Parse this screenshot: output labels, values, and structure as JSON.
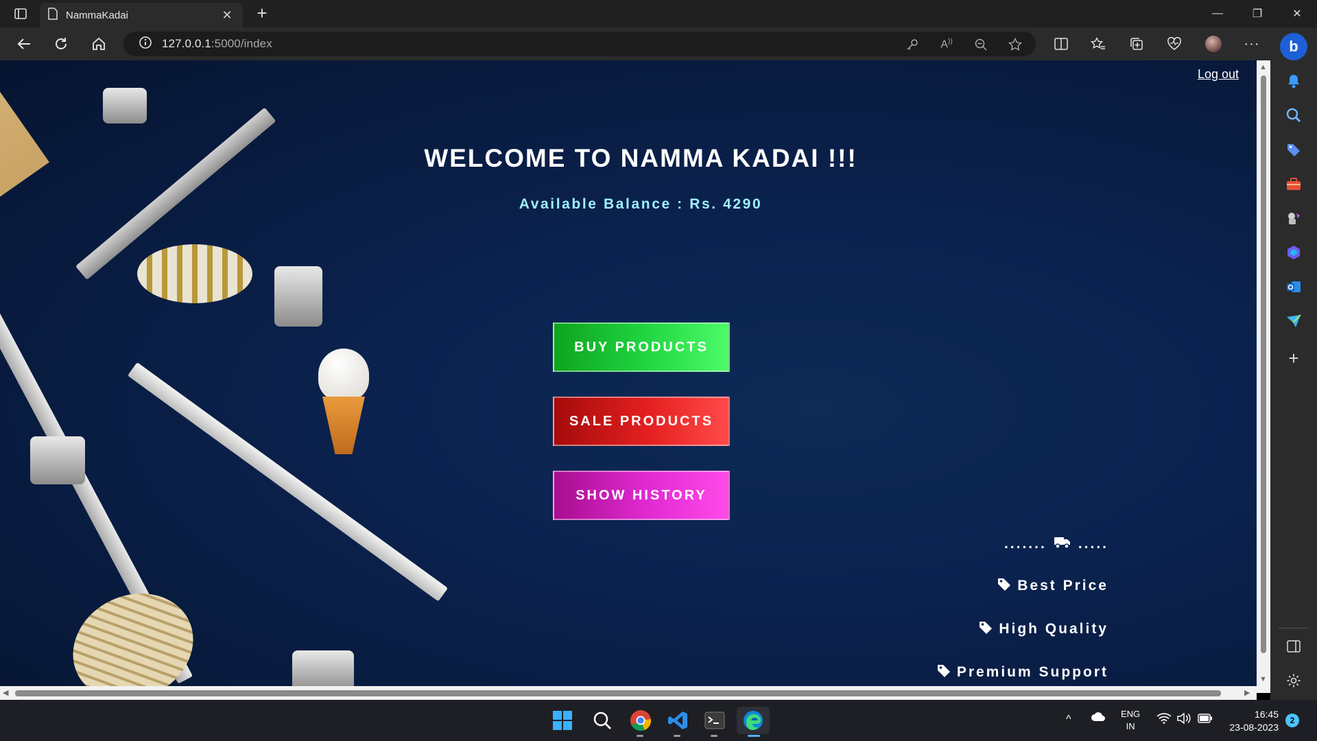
{
  "browser": {
    "tab_title": "NammaKadai",
    "url_host": "127.0.0.1",
    "url_path": ":5000/index"
  },
  "page": {
    "logout_label": "Log out",
    "welcome": "WELCOME TO NAMMA KADAI !!!",
    "balance": "Available Balance : Rs. 4290",
    "buttons": {
      "buy": "BUY PRODUCTS",
      "sale": "SALE PRODUCTS",
      "history": "SHOW HISTORY"
    },
    "features": {
      "delivery_dots_left": ".......",
      "delivery_dots_right": ".....",
      "best_price": "Best Price",
      "high_quality": "High Quality",
      "premium_support": "Premium Support"
    }
  },
  "taskbar": {
    "lang_top": "ENG",
    "lang_bottom": "IN",
    "time": "16:45",
    "date": "23-08-2023",
    "notification_count": "2"
  },
  "colors": {
    "background": "#0b2350",
    "buy": "#1fd33f",
    "sale": "#e52020",
    "history": "#e22bd3",
    "balance_text": "#9ff0ff"
  }
}
